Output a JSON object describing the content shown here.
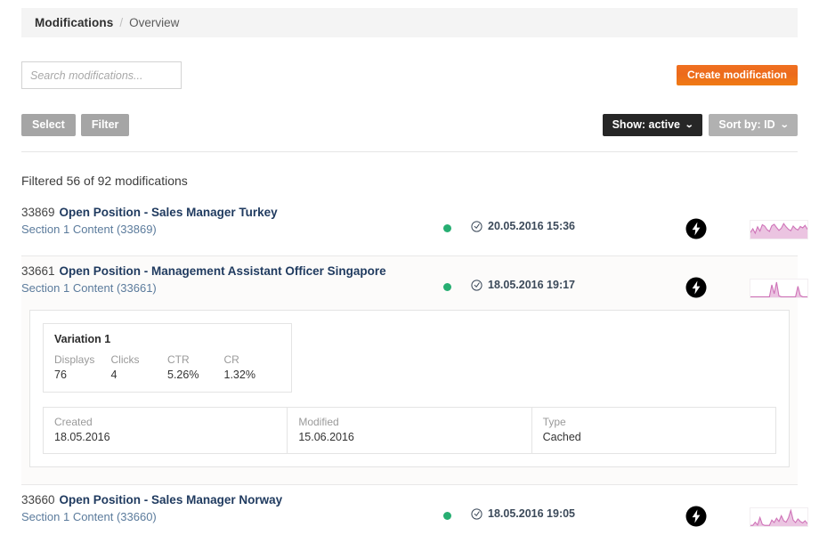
{
  "breadcrumb": {
    "current": "Modifications",
    "separator": "/",
    "sub": "Overview"
  },
  "search": {
    "placeholder": "Search modifications...",
    "value": ""
  },
  "actions": {
    "create_label": "Create modification",
    "create_color": "#ee6c1b"
  },
  "toolbar": {
    "select_label": "Select",
    "filter_label": "Filter",
    "show_label": "Show: active",
    "sort_label": "Sort by: ID",
    "caret": "⌄"
  },
  "list": {
    "filter_count_text": "Filtered 56 of 92 modifications",
    "status_color": "#27ae72",
    "spark_color": "#cf73b8",
    "rows": [
      {
        "id": "33869",
        "title": "Open Position - Sales Manager Turkey",
        "subtitle": "Section 1 Content (33869)",
        "status": "active",
        "date": "20.05.2016 15:36",
        "bolt": "lightning-icon",
        "expanded": false,
        "sparkline": {
          "type": "area",
          "values": [
            34,
            55,
            30,
            66,
            42,
            78,
            70,
            50,
            40,
            72,
            80,
            62,
            46,
            58,
            84,
            66,
            52,
            44,
            70,
            56,
            48,
            68,
            60,
            74,
            52
          ],
          "ymax": 100
        }
      },
      {
        "id": "33661",
        "title": "Open Position - Management Assistant Officer Singapore",
        "subtitle": "Section 1 Content (33661)",
        "status": "active",
        "date": "18.05.2016 19:17",
        "bolt": "lightning-icon",
        "expanded": true,
        "sparkline": {
          "type": "area",
          "values": [
            3,
            3,
            3,
            3,
            3,
            3,
            3,
            3,
            3,
            70,
            20,
            85,
            8,
            3,
            3,
            3,
            3,
            3,
            3,
            3,
            62,
            10,
            3,
            3,
            3
          ],
          "ymax": 100
        },
        "detail": {
          "variation": {
            "title": "Variation 1",
            "metrics": [
              {
                "label": "Displays",
                "value": "76"
              },
              {
                "label": "Clicks",
                "value": "4"
              },
              {
                "label": "CTR",
                "value": "5.26%"
              },
              {
                "label": "CR",
                "value": "1.32%"
              }
            ]
          },
          "meta": [
            {
              "label": "Created",
              "value": "18.05.2016"
            },
            {
              "label": "Modified",
              "value": "15.06.2016"
            },
            {
              "label": "Type",
              "value": "Cached"
            }
          ]
        }
      },
      {
        "id": "33660",
        "title": "Open Position - Sales Manager Norway",
        "subtitle": "Section 1 Content (33660)",
        "status": "active",
        "date": "18.05.2016 19:05",
        "bolt": "lightning-icon",
        "expanded": false,
        "sparkline": {
          "type": "area",
          "values": [
            4,
            4,
            22,
            6,
            48,
            10,
            4,
            4,
            4,
            34,
            20,
            44,
            26,
            58,
            30,
            22,
            46,
            88,
            34,
            20,
            40,
            26,
            18,
            30,
            14
          ],
          "ymax": 100
        }
      }
    ]
  }
}
